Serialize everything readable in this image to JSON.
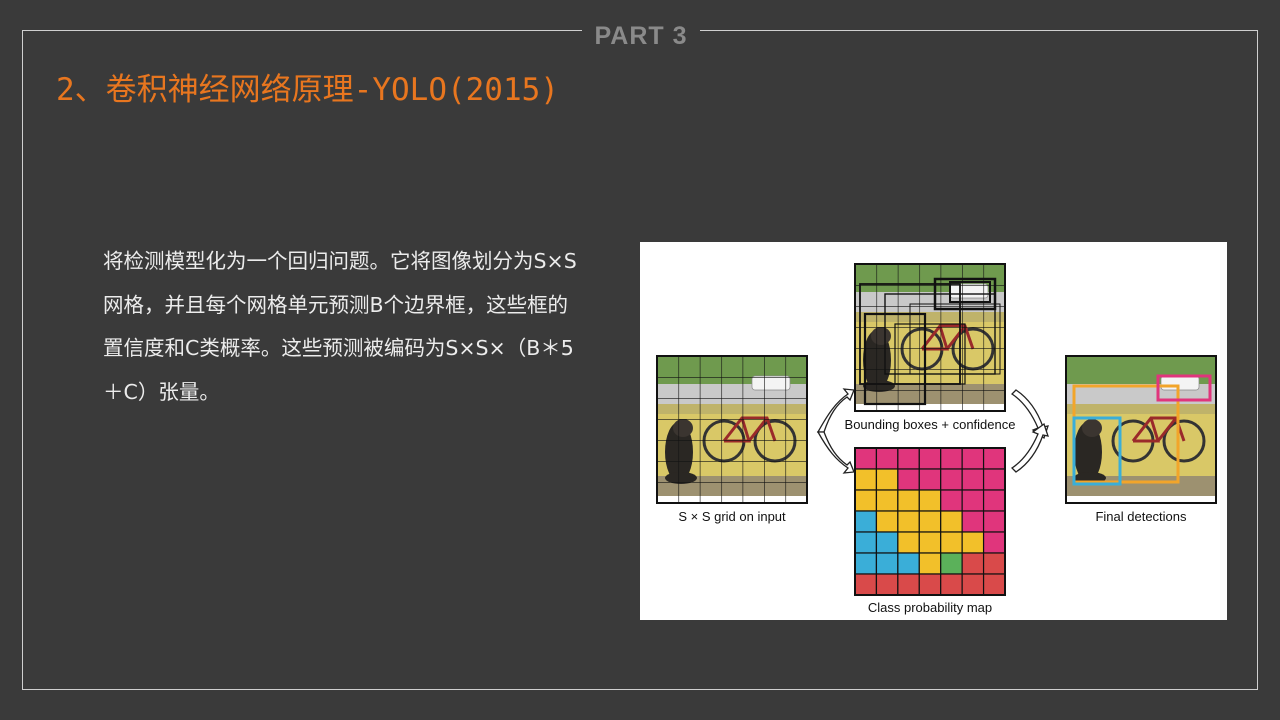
{
  "header": {
    "part_label": "PART 3"
  },
  "slide": {
    "title": "2、卷积神经网络原理-YOLO(2015)",
    "description": "将检测模型化为一个回归问题。它将图像划分为S×S网格，并且每个网格单元预测B个边界框，这些框的置信度和C类概率。这些预测被编码为S×S×（B＊5＋C）张量。"
  },
  "figure": {
    "captions": {
      "input": "S × S grid on input",
      "boxes": "Bounding boxes + confidence",
      "class_map": "Class probability map",
      "final": "Final detections"
    },
    "colors": {
      "pink": "#e0357c",
      "yellow": "#f2c02a",
      "cyan": "#3aaed8",
      "green": "#5bb15a",
      "red": "#d94a4a",
      "orange_box": "#f2a52a"
    }
  }
}
